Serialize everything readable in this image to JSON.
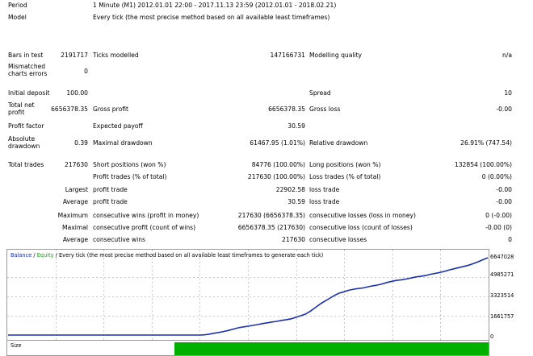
{
  "header": {
    "period_label": "Period",
    "period_value": "1 Minute (M1) 2012.01.01 22:00 - 2017.11.13 23:59 (2012.01.01 - 2018.02.21)",
    "model_label": "Model",
    "model_value": "Every tick (the most precise method based on all available least timeframes)"
  },
  "stats": {
    "bars_label": "Bars in test",
    "bars_value": "2191717",
    "ticks_label": "Ticks modelled",
    "ticks_value": "147166731",
    "quality_label": "Modelling quality",
    "quality_value": "n/a",
    "mismatch_label": "Mismatched charts errors",
    "mismatch_value": "0",
    "deposit_label": "Initial deposit",
    "deposit_value": "100.00",
    "spread_label": "Spread",
    "spread_value": "10",
    "net_label": "Total net profit",
    "net_value": "6656378.35",
    "gross_profit_label": "Gross profit",
    "gross_profit_value": "6656378.35",
    "gross_loss_label": "Gross loss",
    "gross_loss_value": "-0.00",
    "pf_label": "Profit factor",
    "pf_value": "",
    "payoff_label": "Expected payoff",
    "payoff_value": "30.59",
    "abs_dd_label": "Absolute drawdown",
    "abs_dd_value": "0.39",
    "max_dd_label": "Maximal drawdown",
    "max_dd_value": "61467.95 (1.01%)",
    "rel_dd_label": "Relative drawdown",
    "rel_dd_value": "26.91% (747.54)",
    "trades_label": "Total trades",
    "trades_value": "217630",
    "short_label": "Short positions (won %)",
    "short_value": "84776 (100.00%)",
    "long_label": "Long positions (won %)",
    "long_value": "132854 (100.00%)",
    "profit_trades_label": "Profit trades (% of total)",
    "profit_trades_value": "217630 (100.00%)",
    "loss_trades_label": "Loss trades (% of total)",
    "loss_trades_value": "0 (0.00%)",
    "largest_label": "Largest",
    "largest_profit_label": "profit trade",
    "largest_profit_value": "22902.58",
    "largest_loss_label": "loss trade",
    "largest_loss_value": "-0.00",
    "average_label": "Average",
    "average_profit_label": "profit trade",
    "average_profit_value": "30.59",
    "average_loss_label": "loss trade",
    "average_loss_value": "-0.00",
    "maximum_label": "Maximum",
    "max_wins_label": "consecutive wins (profit in money)",
    "max_wins_value": "217630 (6656378.35)",
    "max_losses_label": "consecutive losses (loss in money)",
    "max_losses_value": "0 (-0.00)",
    "maximal_label": "Maximal",
    "maximal_profit_label": "consecutive profit (count of wins)",
    "maximal_profit_value": "6656378.35 (217630)",
    "maximal_loss_label": "consecutive loss (count of losses)",
    "maximal_loss_value": "-0.00 (0)",
    "average2_label": "Average",
    "avg_wins_label": "consecutive wins",
    "avg_wins_value": "217630",
    "avg_losses_label": "consecutive losses",
    "avg_losses_value": "0"
  },
  "graph": {
    "title_balance": "Balance",
    "title_sep": " / ",
    "title_equity": "Equity",
    "title_rest": " / Every tick (the most precise method based on all available least timeframes to generate each tick)",
    "y_ticks": [
      "6647028",
      "4985271",
      "3323514",
      "1661757",
      "0"
    ],
    "size_label": "Size"
  },
  "colors": {
    "balance": "#1a2fb3",
    "equity": "#20a020",
    "size_bar": "#00b000",
    "grid": "#c8c8c8"
  },
  "chart_data": {
    "type": "line",
    "title": "",
    "series": [
      {
        "name": "Balance",
        "values": [
          0,
          0,
          0,
          0,
          0,
          0,
          0,
          0,
          0,
          0,
          0,
          0,
          0,
          0,
          0,
          0,
          0,
          0,
          0,
          0,
          0,
          0,
          0,
          0,
          0,
          0,
          0,
          0,
          0,
          0,
          0,
          0,
          0,
          0,
          0,
          0,
          0,
          0,
          0,
          0,
          0,
          20000,
          80000,
          160000,
          230000,
          310000,
          400000,
          520000,
          620000,
          700000,
          760000,
          830000,
          900000,
          980000,
          1050000,
          1120000,
          1180000,
          1260000,
          1320000,
          1400000,
          1520000,
          1660000,
          1800000,
          2050000,
          2350000,
          2650000,
          2900000,
          3150000,
          3400000,
          3600000,
          3720000,
          3850000,
          3940000,
          4000000,
          4050000,
          4150000,
          4230000,
          4300000,
          4400000,
          4520000,
          4620000,
          4700000,
          4750000,
          4820000,
          4900000,
          5000000,
          5050000,
          5120000,
          5220000,
          5300000,
          5380000,
          5480000,
          5600000,
          5700000,
          5800000,
          5900000,
          6000000,
          6150000,
          6300000,
          6480000,
          6647028
        ]
      }
    ],
    "ylim": [
      0,
      6647028
    ],
    "grid": true
  }
}
